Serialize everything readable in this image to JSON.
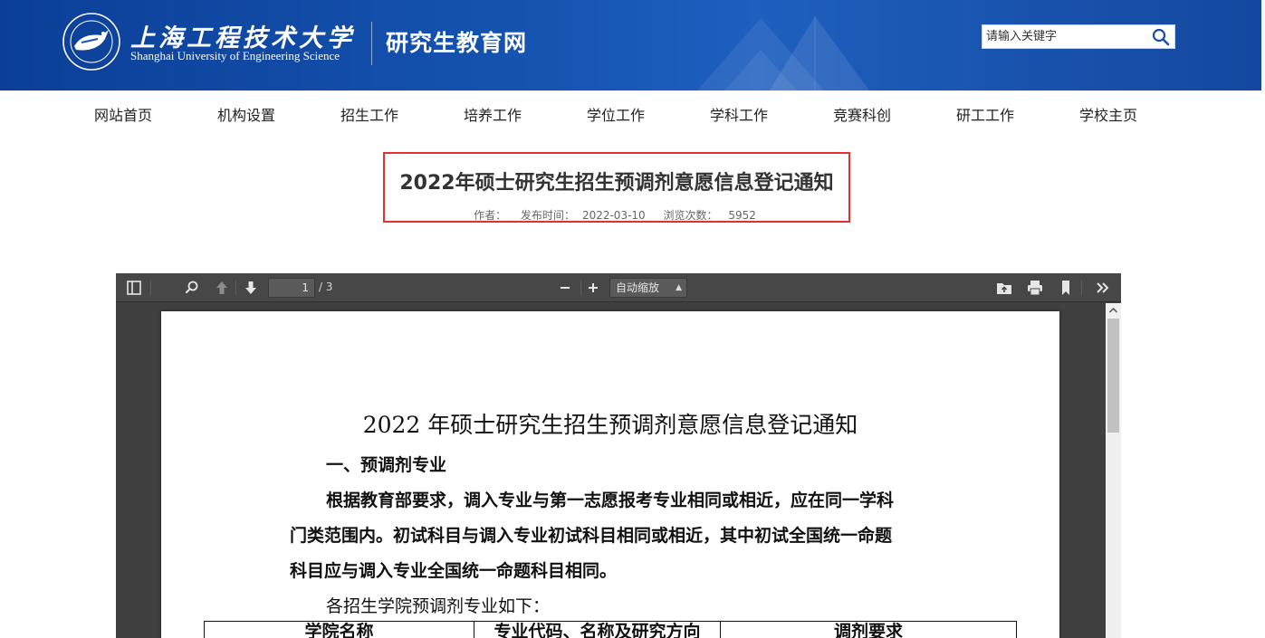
{
  "header": {
    "university_cn": "上海工程技术大学",
    "university_en": "Shanghai University of Engineering Science",
    "site_name": "研究生教育网",
    "search_placeholder": "请输入关键字"
  },
  "nav": {
    "items": [
      "网站首页",
      "机构设置",
      "招生工作",
      "培养工作",
      "学位工作",
      "学科工作",
      "竞赛科创",
      "研工工作",
      "学校主页"
    ]
  },
  "article": {
    "title": "2022年硕士研究生招生预调剂意愿信息登记通知",
    "author_label": "作者：",
    "publish_label": "发布时间：",
    "publish_date": "2022-03-10",
    "views_label": "浏览次数：",
    "views": "5952"
  },
  "pdf_viewer": {
    "current_page": "1",
    "total_pages": "/ 3",
    "zoom": "自动缩放",
    "document": {
      "title": "2022 年硕士研究生招生预调剂意愿信息登记通知",
      "section1": "一、预调剂专业",
      "para_line1": "根据教育部要求，调入专业与第一志愿报考专业相同或相近，应在同一学科",
      "para_line2": "门类范围内。初试科目与调入专业初试科目相同或相近，其中初试全国统一命题",
      "para_line3": "科目应与调入专业全国统一命题科目相同。",
      "list_intro": "各招生学院预调剂专业如下：",
      "table_headers": [
        "学院名称",
        "专业代码、名称及研究方向",
        "调剂要求"
      ]
    }
  },
  "colors": {
    "banner": "#1655b3",
    "highlight_border": "#e03131",
    "viewer_bg": "#404040",
    "toolbar_bg": "#474747"
  }
}
